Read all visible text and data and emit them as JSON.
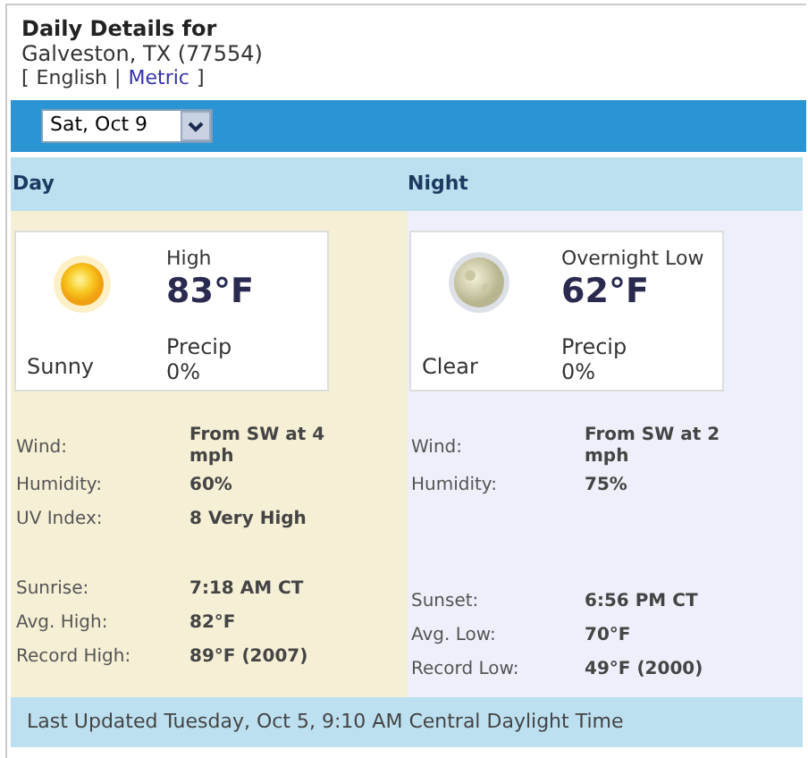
{
  "header": {
    "title": "Daily Details for",
    "location": "Galveston, TX (77554)",
    "bracket_open": "[",
    "separator": "|",
    "bracket_close": "]",
    "links": [
      {
        "label": "English",
        "selected": true
      },
      {
        "label": "Metric",
        "selected": false
      }
    ]
  },
  "date_select": {
    "value": "Sat, Oct 9"
  },
  "columns": [
    {
      "heading": "Day",
      "kind": "sun",
      "condition": "Sunny",
      "temp_label": "High",
      "temp": "83°F",
      "precip_label": "Precip",
      "precip": "0%",
      "details": [
        {
          "label": "Wind:",
          "value": "From SW at 4 mph"
        },
        {
          "label": "Humidity:",
          "value": "60%"
        },
        {
          "label": "UV Index:",
          "value": "8 Very High"
        }
      ],
      "almanac": [
        {
          "label": "Sunrise:",
          "value": "7:18 AM CT"
        },
        {
          "label": "Avg. High:",
          "value": "82°F"
        },
        {
          "label": "Record High:",
          "value": "89°F (2007)"
        }
      ]
    },
    {
      "heading": "Night",
      "kind": "moon",
      "condition": "Clear",
      "temp_label": "Overnight Low",
      "temp": "62°F",
      "precip_label": "Precip",
      "precip": "0%",
      "details": [
        {
          "label": "Wind:",
          "value": "From SW at 2 mph"
        },
        {
          "label": "Humidity:",
          "value": "75%"
        }
      ],
      "almanac": [
        {
          "label": "Sunset:",
          "value": "6:56 PM CT"
        },
        {
          "label": "Avg. Low:",
          "value": "70°F"
        },
        {
          "label": "Record Low:",
          "value": "49°F (2000)"
        }
      ]
    }
  ],
  "footer": "Last Updated Tuesday, Oct 5, 9:10 AM Central Daylight Time"
}
